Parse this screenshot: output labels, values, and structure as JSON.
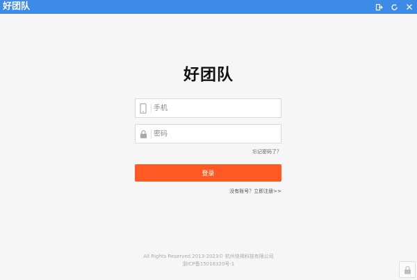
{
  "window": {
    "title": "好团队"
  },
  "header": {
    "logo_text": "好团队"
  },
  "form": {
    "phone_placeholder": "手机",
    "password_placeholder": "密码",
    "forgot_label": "忘记密码了？",
    "login_label": "登录",
    "register_label": "没有账号？立即注册>>"
  },
  "footer": {
    "copyright": "All Rights Reserved 2013-2023© 杭州快褐科技有限公司",
    "icp": "浙ICP备15018320号-1"
  },
  "icons": {
    "minimize_restore": "restore-icon",
    "refresh": "refresh-icon",
    "close": "close-icon",
    "phone": "phone-icon",
    "lock": "lock-icon"
  },
  "colors": {
    "titlebar": "#3d8be6",
    "primary": "#ff5a24",
    "background": "#f6f6f6"
  }
}
